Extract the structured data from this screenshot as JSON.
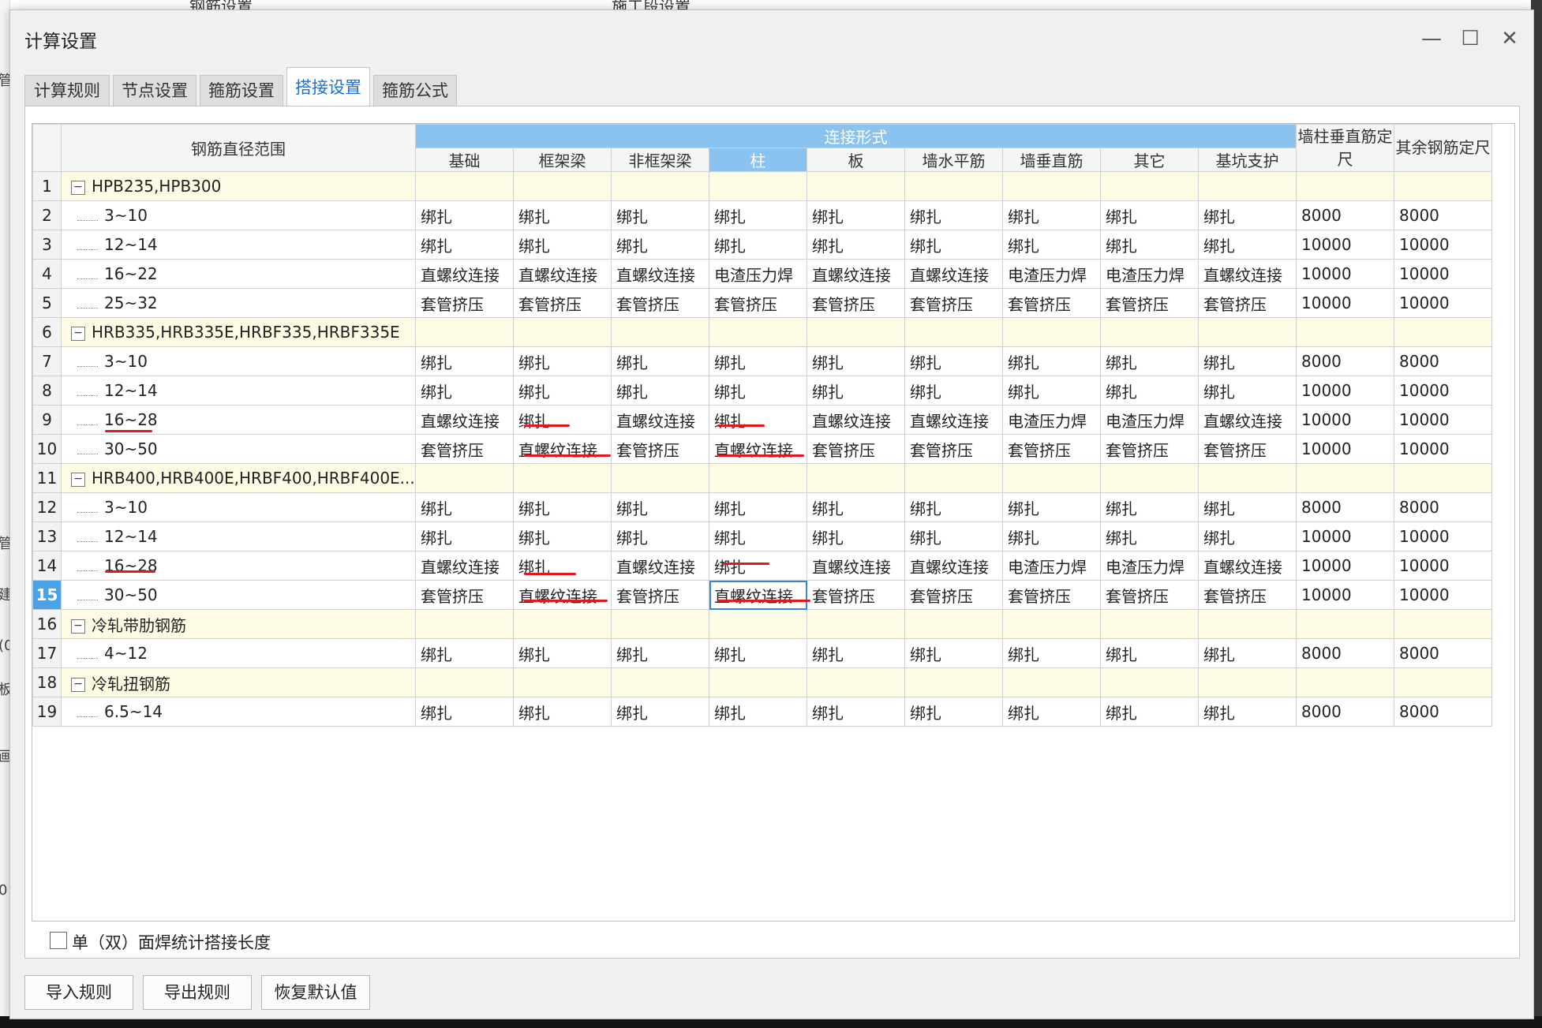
{
  "background": {
    "top_texts": [
      "钢筋设置",
      "施工段设置"
    ],
    "left_texts": [
      "管",
      "管",
      "建",
      "板",
      "(0",
      "0",
      "画"
    ]
  },
  "dialog": {
    "title": "计算设置",
    "controls": {
      "minimize": "—",
      "maximize": "☐",
      "close": "✕"
    }
  },
  "tabs": [
    "计算规则",
    "节点设置",
    "箍筋设置",
    "搭接设置",
    "箍筋公式"
  ],
  "active_tab": 3,
  "table": {
    "header": {
      "range": "钢筋直径范围",
      "group": "连接形式",
      "sub": [
        "基础",
        "框架梁",
        "非框架梁",
        "柱",
        "板",
        "墙水平筋",
        "墙垂直筋",
        "其它",
        "基坑支护"
      ],
      "wall_vertical_length": "墙柱垂直筋定尺",
      "other_length": "其余钢筋定尺"
    },
    "rows": [
      {
        "n": "1",
        "group": true,
        "label": "HPB235,HPB300"
      },
      {
        "n": "2",
        "label": "3~10",
        "cells": [
          "绑扎",
          "绑扎",
          "绑扎",
          "绑扎",
          "绑扎",
          "绑扎",
          "绑扎",
          "绑扎",
          "绑扎"
        ],
        "l1": "8000",
        "l2": "8000"
      },
      {
        "n": "3",
        "label": "12~14",
        "cells": [
          "绑扎",
          "绑扎",
          "绑扎",
          "绑扎",
          "绑扎",
          "绑扎",
          "绑扎",
          "绑扎",
          "绑扎"
        ],
        "l1": "10000",
        "l2": "10000"
      },
      {
        "n": "4",
        "label": "16~22",
        "cells": [
          "直螺纹连接",
          "直螺纹连接",
          "直螺纹连接",
          "电渣压力焊",
          "直螺纹连接",
          "直螺纹连接",
          "电渣压力焊",
          "电渣压力焊",
          "直螺纹连接"
        ],
        "l1": "10000",
        "l2": "10000"
      },
      {
        "n": "5",
        "label": "25~32",
        "cells": [
          "套管挤压",
          "套管挤压",
          "套管挤压",
          "套管挤压",
          "套管挤压",
          "套管挤压",
          "套管挤压",
          "套管挤压",
          "套管挤压"
        ],
        "l1": "10000",
        "l2": "10000"
      },
      {
        "n": "6",
        "group": true,
        "label": "HRB335,HRB335E,HRBF335,HRBF335E"
      },
      {
        "n": "7",
        "label": "3~10",
        "cells": [
          "绑扎",
          "绑扎",
          "绑扎",
          "绑扎",
          "绑扎",
          "绑扎",
          "绑扎",
          "绑扎",
          "绑扎"
        ],
        "l1": "8000",
        "l2": "8000"
      },
      {
        "n": "8",
        "label": "12~14",
        "cells": [
          "绑扎",
          "绑扎",
          "绑扎",
          "绑扎",
          "绑扎",
          "绑扎",
          "绑扎",
          "绑扎",
          "绑扎"
        ],
        "l1": "10000",
        "l2": "10000"
      },
      {
        "n": "9",
        "label": "16~28",
        "cells": [
          "直螺纹连接",
          "绑扎",
          "直螺纹连接",
          "绑扎",
          "直螺纹连接",
          "直螺纹连接",
          "电渣压力焊",
          "电渣压力焊",
          "直螺纹连接"
        ],
        "l1": "10000",
        "l2": "10000"
      },
      {
        "n": "10",
        "label": "30~50",
        "cells": [
          "套管挤压",
          "直螺纹连接",
          "套管挤压",
          "直螺纹连接",
          "套管挤压",
          "套管挤压",
          "套管挤压",
          "套管挤压",
          "套管挤压"
        ],
        "l1": "10000",
        "l2": "10000"
      },
      {
        "n": "11",
        "group": true,
        "label": "HRB400,HRB400E,HRBF400,HRBF400E..."
      },
      {
        "n": "12",
        "label": "3~10",
        "cells": [
          "绑扎",
          "绑扎",
          "绑扎",
          "绑扎",
          "绑扎",
          "绑扎",
          "绑扎",
          "绑扎",
          "绑扎"
        ],
        "l1": "8000",
        "l2": "8000"
      },
      {
        "n": "13",
        "label": "12~14",
        "cells": [
          "绑扎",
          "绑扎",
          "绑扎",
          "绑扎",
          "绑扎",
          "绑扎",
          "绑扎",
          "绑扎",
          "绑扎"
        ],
        "l1": "10000",
        "l2": "10000"
      },
      {
        "n": "14",
        "label": "16~28",
        "cells": [
          "直螺纹连接",
          "绑扎",
          "直螺纹连接",
          "绑扎",
          "直螺纹连接",
          "直螺纹连接",
          "电渣压力焊",
          "电渣压力焊",
          "直螺纹连接"
        ],
        "l1": "10000",
        "l2": "10000"
      },
      {
        "n": "15",
        "label": "30~50",
        "current": true,
        "cells": [
          "套管挤压",
          "直螺纹连接",
          "套管挤压",
          "直螺纹连接",
          "套管挤压",
          "套管挤压",
          "套管挤压",
          "套管挤压",
          "套管挤压"
        ],
        "l1": "10000",
        "l2": "10000"
      },
      {
        "n": "16",
        "group": true,
        "label": "冷轧带肋钢筋"
      },
      {
        "n": "17",
        "label": "4~12",
        "cells": [
          "绑扎",
          "绑扎",
          "绑扎",
          "绑扎",
          "绑扎",
          "绑扎",
          "绑扎",
          "绑扎",
          "绑扎"
        ],
        "l1": "8000",
        "l2": "8000"
      },
      {
        "n": "18",
        "group": true,
        "label": "冷轧扭钢筋"
      },
      {
        "n": "19",
        "label": "6.5~14",
        "cells": [
          "绑扎",
          "绑扎",
          "绑扎",
          "绑扎",
          "绑扎",
          "绑扎",
          "绑扎",
          "绑扎",
          "绑扎"
        ],
        "l1": "8000",
        "l2": "8000"
      }
    ]
  },
  "options": {
    "weld_length": "单（双）面焊统计搭接长度"
  },
  "buttons": [
    "导入规则",
    "导出规则",
    "恢复默认值"
  ],
  "colors": {
    "header_blue": "#8ac3ef",
    "group_row": "#fdfbe4",
    "annotation_red": "#e0191f",
    "tab_active_text": "#1e6fd9"
  }
}
